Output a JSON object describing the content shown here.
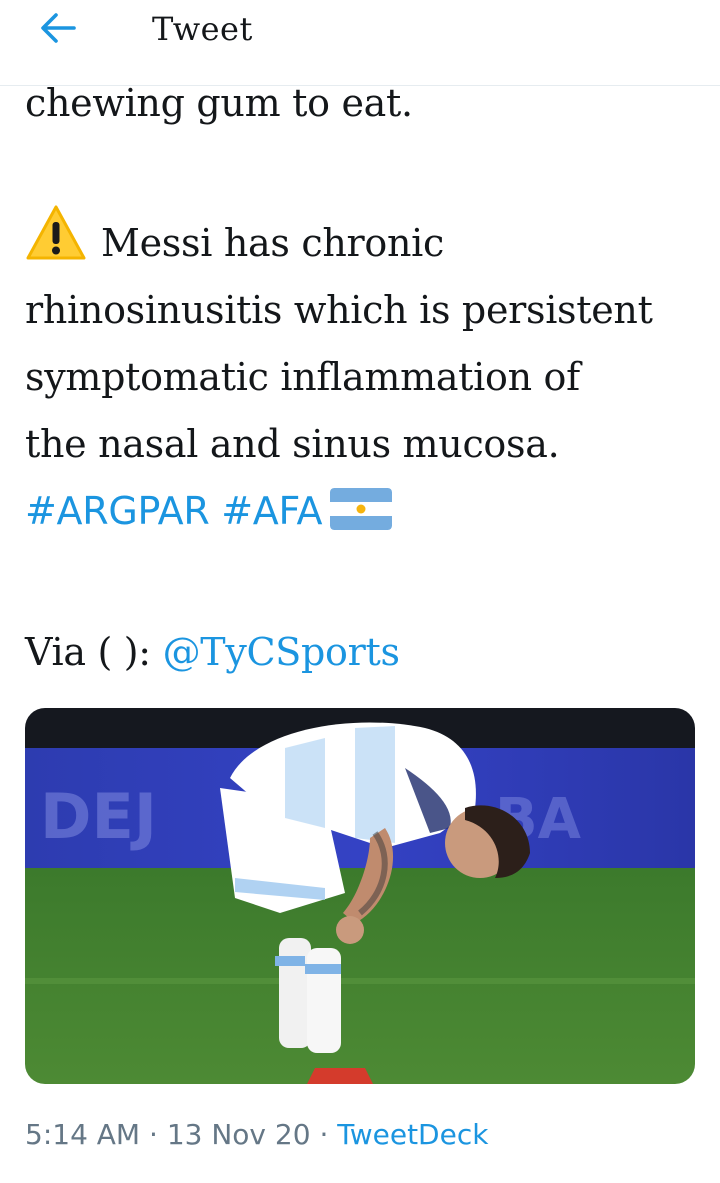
{
  "header": {
    "back_icon": "arrow-left-icon",
    "title": "Tweet"
  },
  "tweet": {
    "line_top": "chewing gum to eat.",
    "warning_icon": "warning-icon",
    "body_lines": [
      "Messi has chronic",
      "rhinosinusitis which is persistent",
      "symptomatic inflammation of",
      "the nasal and sinus mucosa."
    ],
    "hashtags": [
      "#ARGPAR",
      "#AFA"
    ],
    "flag_icon": "argentina-flag-icon",
    "via_label": "Via ( ):",
    "mention": "@TyCSports"
  },
  "media": {
    "description": "photo"
  },
  "meta": {
    "time": "5:14 AM",
    "separator": "·",
    "date": "13 Nov 20",
    "source": "TweetDeck"
  },
  "colors": {
    "link": "#1b95e0",
    "meta": "#657786",
    "text": "#14171a"
  }
}
